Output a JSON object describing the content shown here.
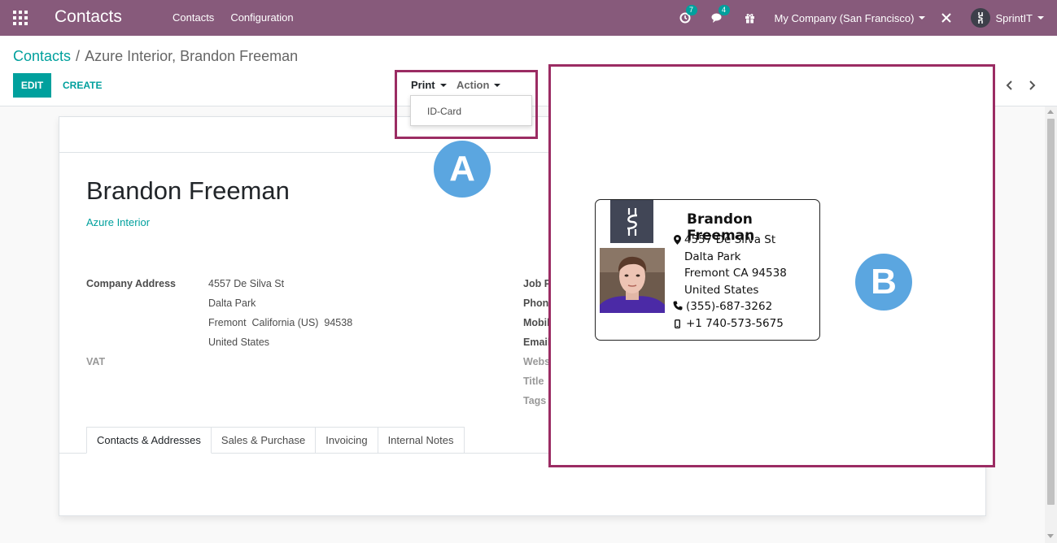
{
  "navbar": {
    "app_name": "Contacts",
    "menu": [
      "Contacts",
      "Configuration"
    ],
    "activity_count": "7",
    "messages_count": "4",
    "company": "My Company (San Francisco)",
    "user": "SprintIT"
  },
  "breadcrumb": {
    "parent": "Contacts",
    "separator": "/",
    "current": "Azure Interior, Brandon Freeman"
  },
  "buttons": {
    "edit": "EDIT",
    "create": "CREATE",
    "print": "Print",
    "action": "Action"
  },
  "print_menu": {
    "items": [
      "ID-Card"
    ]
  },
  "form": {
    "name": "Brandon Freeman",
    "company": "Azure Interior",
    "company_address_label": "Company Address",
    "address_lines": [
      "4557 De Silva St",
      "Dalta Park",
      "Fremont  California (US)  94538",
      "United States"
    ],
    "vat_label": "VAT",
    "right_labels": [
      "Job P",
      "Phone",
      "Mobil",
      "Email",
      "Webs",
      "Title",
      "Tags"
    ],
    "tabs": [
      "Contacts & Addresses",
      "Sales & Purchase",
      "Invoicing",
      "Internal Notes"
    ]
  },
  "id_card": {
    "name": "Brandon Freeman",
    "address_lines": [
      "4557 De Silva St",
      "Dalta Park",
      "Fremont CA 94538",
      "United States"
    ],
    "phone": "(355)-687-3262",
    "mobile": "+1 740-573-5675"
  },
  "annotations": {
    "a": "A",
    "b": "B"
  },
  "colors": {
    "brand": "#875a7b",
    "accent": "#00a09d",
    "annotation_border": "#9b2c63",
    "annotation_circle": "#5ba6e0"
  }
}
